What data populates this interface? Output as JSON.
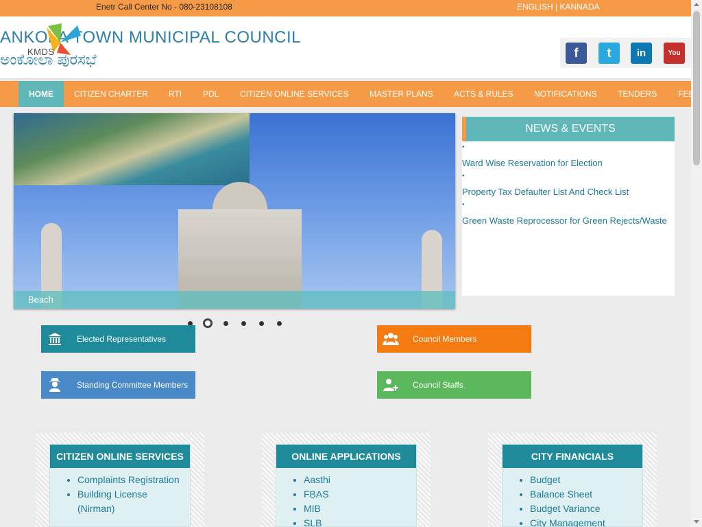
{
  "topbar": {
    "call_center": "Enetr Call Center No - 080-23108108",
    "lang_english": "ENGLISH",
    "lang_sep": " | ",
    "lang_kannada": "KANNADA"
  },
  "header": {
    "title_en": "ANKOLA TOWN MUNICIPAL COUNCIL",
    "title_kn": "ಅಂಕೋಲಾ ಪುರಸಭೆ",
    "logo_text": "KMDS",
    "social": [
      {
        "name": "facebook-icon",
        "glyph": "f"
      },
      {
        "name": "twitter-icon",
        "glyph": "t"
      },
      {
        "name": "linkedin-icon",
        "glyph": "in"
      },
      {
        "name": "youtube-icon",
        "glyph": "You Tube"
      }
    ]
  },
  "nav": {
    "items": [
      "HOME",
      "CITIZEN CHARTER",
      "RTI",
      "PDL",
      "CITIZEN ONLINE SERVICES",
      "MASTER PLANS",
      "ACTS & RULES",
      "NOTIFICATIONS",
      "TENDERS",
      "FEE"
    ]
  },
  "slider": {
    "caption": "Beach",
    "dot_count": 6,
    "active_dot": 2
  },
  "news": {
    "heading": "NEWS & EVENTS",
    "items": [
      "Ward Wise Reservation for Election",
      "Property Tax Defaulter List And Check List",
      "Green Waste Reprocessor for Green Rejects/Waste"
    ]
  },
  "quick_links": {
    "elected": "Elected Representatives",
    "council_members": "Council Members",
    "standing": "Standing Committee Members",
    "staffs": "Council Staffs"
  },
  "panels": [
    {
      "title": "CITIZEN ONLINE SERVICES",
      "items": [
        "Complaints Registration",
        "Building License (Nirman)"
      ]
    },
    {
      "title": "ONLINE APPLICATIONS",
      "items": [
        "Aasthi",
        "FBAS",
        "MIB",
        "SLB"
      ]
    },
    {
      "title": "CITY FINANCIALS",
      "items": [
        "Budget",
        "Balance Sheet",
        "Budget Variance",
        "City Management"
      ]
    }
  ],
  "colors": {
    "orange": "#f59b47",
    "teal": "#5fb7b7",
    "dark_teal": "#1f8a99",
    "link_blue": "#1b7b96"
  }
}
